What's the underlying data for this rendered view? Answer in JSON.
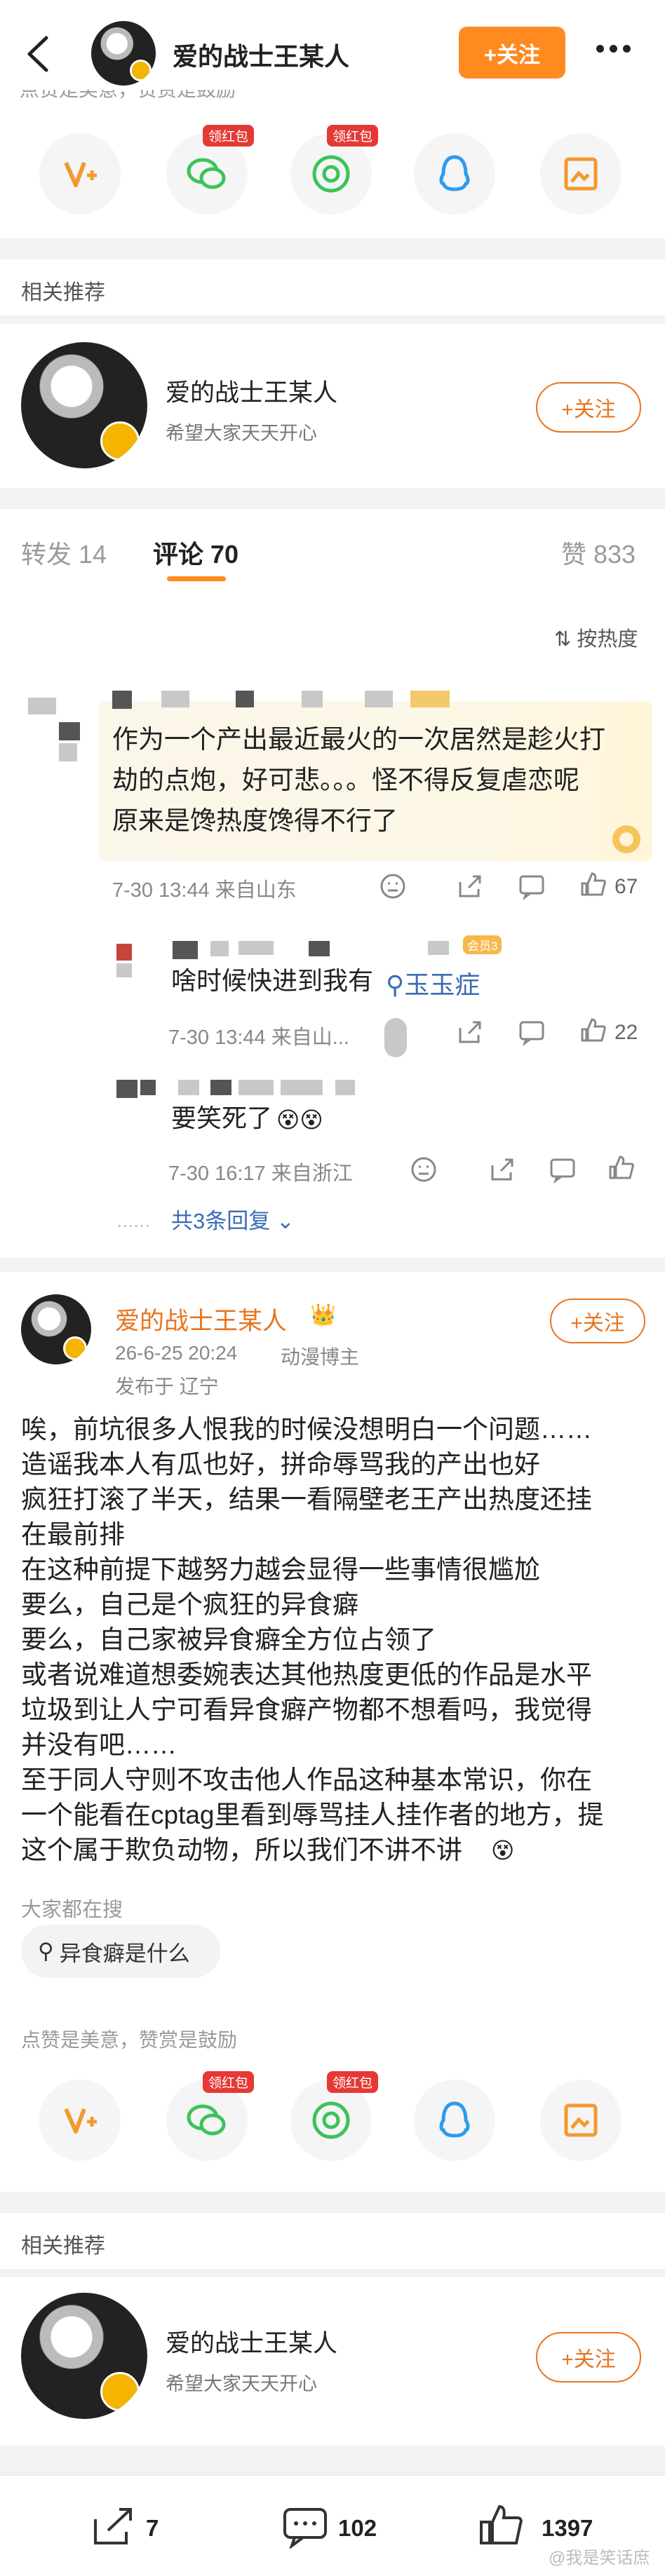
{
  "header": {
    "title": "爱的战士王某人",
    "follow_label": "+关注"
  },
  "top_strip_text": "点赞是美意，赞赏是鼓励",
  "reward": {
    "badge_label": "领红包"
  },
  "related": {
    "section_title": "相关推荐",
    "name": "爱的战士王某人",
    "desc": "希望大家天天开心",
    "follow_label": "+关注"
  },
  "tabs": {
    "repost": "转发 14",
    "comment": "评论 70",
    "like": "赞 833",
    "sort": "按热度"
  },
  "comments": [
    {
      "text_lines": [
        "作为一个产出最近最火的一次居然是趁火打",
        "劫的点炮，好可悲。。。怪不得反复虐恋呢",
        "原来是馋热度馋得不行了"
      ],
      "time": "7-30 13:44 来自山东",
      "likes": "67"
    },
    {
      "text": "啥时候快进到我有",
      "link": "玉玉症",
      "time": "7-30 13:44 来自山...",
      "likes": "22",
      "level_badge": "会员3"
    },
    {
      "text": "要笑死了",
      "time": "7-30 16:17 来自浙江",
      "replies": "共3条回复"
    }
  ],
  "post": {
    "author": "爱的战士王某人",
    "date": "26-6-25 20:24",
    "tag": "动漫博主",
    "location": "发布于 辽宁",
    "follow_label": "+关注",
    "lines": [
      "唉，前坑很多人恨我的时候没想明白一个问题……",
      "造谣我本人有瓜也好，拼命辱骂我的产出也好",
      "疯狂打滚了半天，结果一看隔壁老王产出热度还挂",
      "在最前排",
      "在这种前提下越努力越会显得一些事情很尴尬",
      "要么，自己是个疯狂的异食癖",
      "要么，自己家被异食癖全方位占领了",
      "或者说难道想委婉表达其他热度更低的作品是水平",
      "垃圾到让人宁可看异食癖产物都不想看吗，我觉得",
      "并没有吧……",
      "至于同人守则不攻击他人作品这种基本常识，你在",
      "一个能看在cptag里看到辱骂挂人挂作者的地方，提",
      "这个属于欺负动物，所以我们不讲不讲"
    ],
    "search_title": "大家都在搜",
    "search_chip": "异食癖是什么",
    "reward_text": "点赞是美意，赞赏是鼓励"
  },
  "bottom": {
    "reposts": "7",
    "comments": "102",
    "likes": "1397",
    "watermark": "@我是笑话庶"
  }
}
